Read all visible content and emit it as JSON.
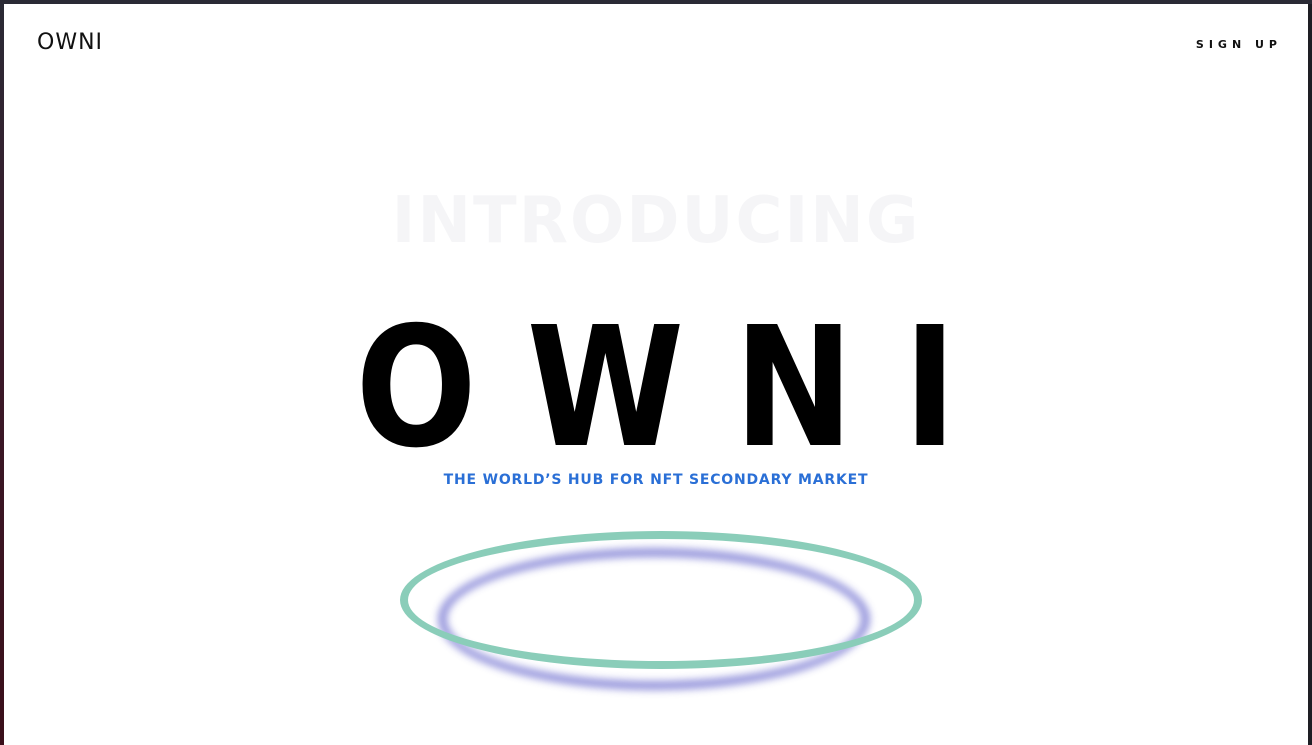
{
  "header": {
    "logo_text": "OWNI",
    "signup_label": "SIGN UP"
  },
  "hero": {
    "intro_text": "INTRODUCING",
    "title": "OWNI",
    "tagline": "THE WORLD’S HUB FOR NFT SECONDARY MARKET"
  },
  "colors": {
    "tagline": "#2a6fd6",
    "ring_outer": "#8acdb9",
    "ring_glow": "#8a8ad8",
    "background": "#ffffff"
  }
}
